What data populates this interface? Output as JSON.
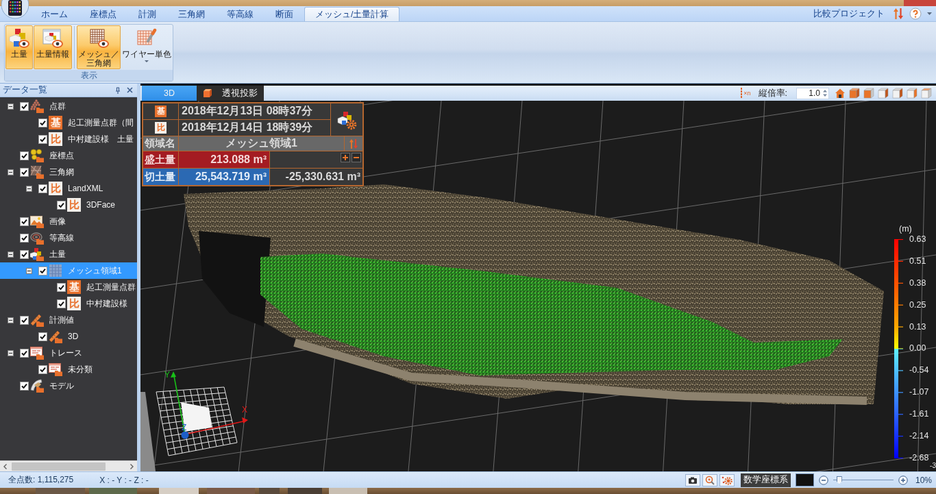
{
  "ribbon": {
    "tabs": [
      {
        "label": "ホーム",
        "selected": false
      },
      {
        "label": "座標点",
        "selected": false
      },
      {
        "label": "計測",
        "selected": false
      },
      {
        "label": "三角網",
        "selected": false
      },
      {
        "label": "等高線",
        "selected": false
      },
      {
        "label": "断面",
        "selected": false
      },
      {
        "label": "メッシュ/土量計算",
        "selected": true
      }
    ],
    "compare_project": "比較プロジェクト",
    "groups": [
      {
        "label": "表示",
        "buttons": [
          {
            "label": "土量",
            "kind": "volume",
            "selected": true,
            "dropdown": false,
            "separator_before": false
          },
          {
            "label": "土量情報",
            "kind": "info",
            "selected": true,
            "dropdown": false,
            "separator_before": false
          },
          {
            "label": "メッシュ／三角網",
            "kind": "mesh",
            "selected": true,
            "dropdown": false,
            "separator_before": true
          },
          {
            "label": "ワイヤー単色",
            "kind": "wire",
            "selected": false,
            "dropdown": true,
            "separator_before": false
          }
        ]
      }
    ]
  },
  "data_panel": {
    "title": "データ一覧",
    "items": [
      {
        "label": "点群",
        "kind": "pointcloud",
        "checked": true,
        "expanded": true,
        "selected": false,
        "children": [
          {
            "label": "起工測量点群（間",
            "kind": "base",
            "badge": "基",
            "checked": true,
            "selected": false
          },
          {
            "label": "中村建設様　土量",
            "kind": "compare",
            "badge": "比",
            "checked": true,
            "selected": false
          }
        ]
      },
      {
        "label": "座標点",
        "kind": "coords",
        "checked": true,
        "selected": false
      },
      {
        "label": "三角網",
        "kind": "tin",
        "checked": true,
        "expanded": true,
        "selected": false,
        "children": [
          {
            "label": "LandXML",
            "kind": "compare",
            "badge": "比",
            "checked": true,
            "expanded": true,
            "selected": false,
            "children": [
              {
                "label": "3DFace",
                "kind": "compare",
                "badge": "比",
                "checked": true,
                "selected": false
              }
            ]
          }
        ]
      },
      {
        "label": "画像",
        "kind": "image",
        "checked": true,
        "selected": false
      },
      {
        "label": "等高線",
        "kind": "contour",
        "checked": true,
        "selected": false
      },
      {
        "label": "土量",
        "kind": "volume",
        "checked": true,
        "expanded": true,
        "selected": false,
        "children": [
          {
            "label": "メッシュ領域1",
            "kind": "mesh",
            "checked": true,
            "expanded": true,
            "selected": true,
            "children": [
              {
                "label": "起工測量点群",
                "kind": "base",
                "badge": "基",
                "checked": true,
                "selected": false
              },
              {
                "label": "中村建設様",
                "kind": "compare",
                "badge": "比",
                "checked": true,
                "selected": false
              }
            ]
          }
        ]
      },
      {
        "label": "計測値",
        "kind": "measure",
        "checked": true,
        "expanded": true,
        "selected": false,
        "children": [
          {
            "label": "3D",
            "kind": "measure",
            "checked": true,
            "selected": false
          }
        ]
      },
      {
        "label": "トレース",
        "kind": "trace",
        "checked": true,
        "expanded": true,
        "selected": false,
        "children": [
          {
            "label": "未分類",
            "kind": "trace",
            "checked": true,
            "selected": false
          }
        ]
      },
      {
        "label": "モデル",
        "kind": "model",
        "checked": true,
        "selected": false
      }
    ]
  },
  "viewport": {
    "tabs": [
      {
        "label": "3D",
        "kind": "plain",
        "selected": true
      },
      {
        "label": "透視投影",
        "kind": "perspective",
        "selected": false
      }
    ],
    "scale_mark": "×n",
    "exaggeration_label": "縦倍率:",
    "exaggeration_value": "1.0",
    "info_table": {
      "dates": [
        {
          "kind": "base",
          "badge": "基",
          "date": "2018年12月13日 08時37分"
        },
        {
          "kind": "compare",
          "badge": "比",
          "date": "2018年12月14日 18時39分"
        }
      ],
      "region_label": "領域名",
      "region_name": "メッシュ領域1",
      "fill": {
        "label": "盛土量",
        "value": "213.088 m³"
      },
      "cut": {
        "label": "切土量",
        "value": "25,543.719 m³"
      },
      "net": "-25,330.631 m³"
    },
    "axes": {
      "x": "X",
      "y": "Y",
      "z": "Z"
    },
    "legend": {
      "unit": "(m)",
      "labels": [
        "0.63",
        "0.51",
        "0.38",
        "0.25",
        "0.13",
        "0.00",
        "-0.54",
        "-1.07",
        "-1.61",
        "-2.14",
        "-2.68"
      ],
      "overflow_label": "-3"
    }
  },
  "status_bar": {
    "point_count": "全点数: 1,115,275",
    "cursor": "X : - Y : - Z : -",
    "coordinate_system": "数学座標系",
    "zoom": {
      "level": 0.1,
      "reading": "10%"
    }
  }
}
